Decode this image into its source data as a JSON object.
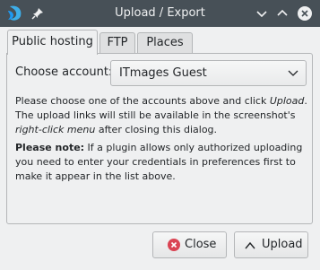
{
  "window": {
    "title": "Upload / Export"
  },
  "tabs": [
    {
      "label": "Public hosting",
      "active": true
    },
    {
      "label": "FTP",
      "active": false
    },
    {
      "label": "Places",
      "active": false
    }
  ],
  "public_hosting": {
    "account_label": "Choose account:",
    "account_selected": "ITmages Guest",
    "info": {
      "part1": "Please choose one of the accounts above and click ",
      "upload_word": "Upload",
      "part2": ". The upload links will still be available in the screenshot's ",
      "context_menu": "right-click menu",
      "part3": " after closing this dialog."
    },
    "note": {
      "bold": "Please note:",
      "text": " If a plugin allows only authorized uploading you need to enter your credentials in preferences first to make it appear in the list above."
    }
  },
  "buttons": {
    "close": "Close",
    "upload": "Upload"
  },
  "colors": {
    "titlebar": "#475057",
    "window_bg": "#eff0f1",
    "close_icon_red": "#da4453"
  },
  "icons": {
    "app": "app-logo-icon",
    "pin": "pin-icon",
    "minimize": "chevron-down-icon",
    "maximize": "chevron-up-icon",
    "close": "close-icon",
    "combo": "chevron-down-icon",
    "close_button": "cancel-circle-icon",
    "upload_button": "chevron-up-icon"
  }
}
